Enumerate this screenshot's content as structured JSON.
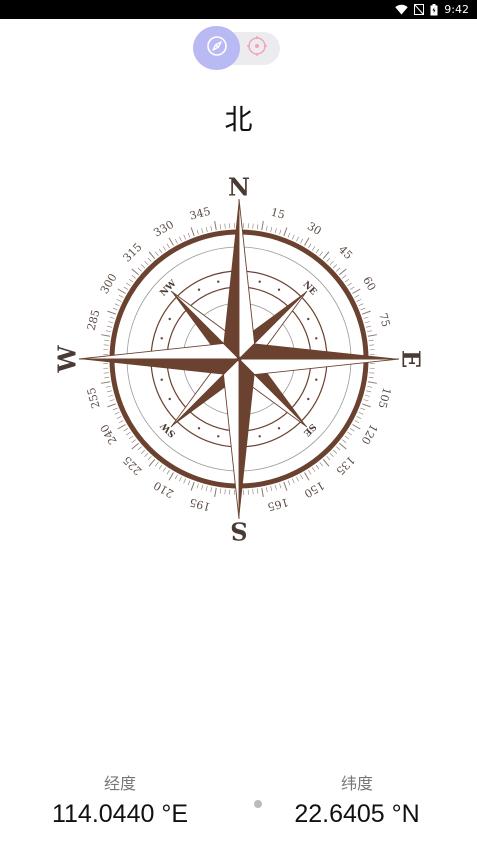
{
  "status_bar": {
    "time": "9:42",
    "battery": "battery-icon",
    "signal": "no-signal-icon",
    "wifi": "wifi-icon"
  },
  "mode_toggle": {
    "active": "compass-mode",
    "inactive": "target-mode"
  },
  "heading": {
    "direction": "北"
  },
  "compass": {
    "cardinals": [
      "N",
      "E",
      "S",
      "W"
    ],
    "intercardinals": [
      "NE",
      "SE",
      "SW",
      "NW"
    ],
    "degree_labels": [
      "15",
      "30",
      "45",
      "60",
      "75",
      "105",
      "120",
      "135",
      "150",
      "165",
      "195",
      "210",
      "225",
      "240",
      "255",
      "285",
      "300",
      "315",
      "330",
      "345"
    ],
    "colors": {
      "rose": "#6b4230",
      "ring": "#6b4230"
    }
  },
  "location": {
    "longitude_label": "经度",
    "longitude_value": "114.0440 °E",
    "latitude_label": "纬度",
    "latitude_value": "22.6405 °N"
  }
}
